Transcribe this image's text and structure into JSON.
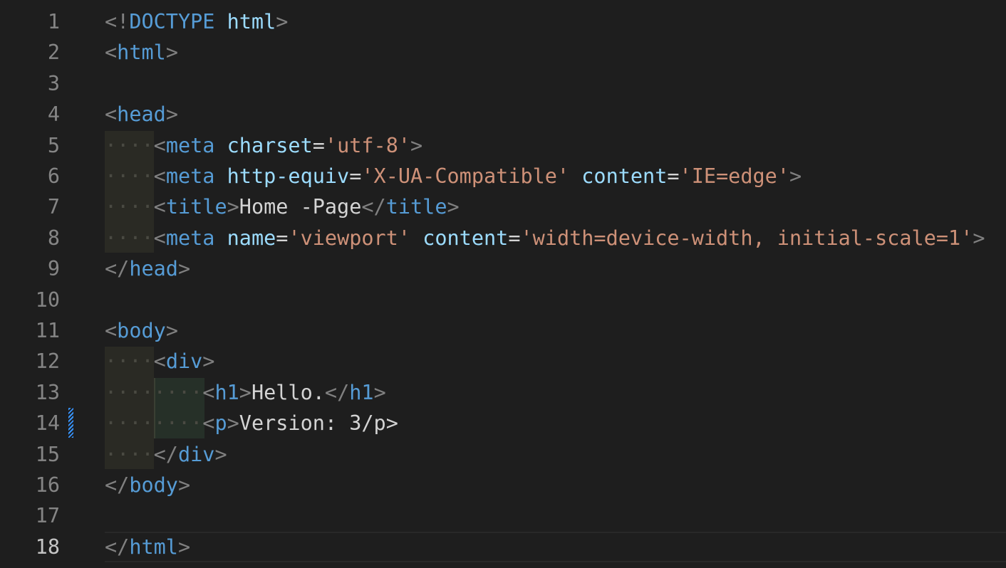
{
  "gutter": {
    "line_numbers": [
      "1",
      "2",
      "3",
      "4",
      "5",
      "6",
      "7",
      "8",
      "9",
      "10",
      "11",
      "12",
      "13",
      "14",
      "15",
      "16",
      "17",
      "18"
    ]
  },
  "code_lines": [
    {
      "tokens": [
        {
          "c": "p",
          "t": "<!"
        },
        {
          "c": "t",
          "t": "DOCTYPE"
        },
        {
          "c": "tx",
          "t": " "
        },
        {
          "c": "a",
          "t": "html"
        },
        {
          "c": "p",
          "t": ">"
        }
      ]
    },
    {
      "tokens": [
        {
          "c": "p",
          "t": "<"
        },
        {
          "c": "t",
          "t": "html"
        },
        {
          "c": "p",
          "t": ">"
        }
      ]
    },
    {
      "tokens": []
    },
    {
      "tokens": [
        {
          "c": "p",
          "t": "<"
        },
        {
          "c": "t",
          "t": "head"
        },
        {
          "c": "p",
          "t": ">"
        }
      ]
    },
    {
      "tokens": [
        {
          "c": "ws",
          "t": "····"
        },
        {
          "c": "p",
          "t": "<"
        },
        {
          "c": "t",
          "t": "meta"
        },
        {
          "c": "tx",
          "t": " "
        },
        {
          "c": "a",
          "t": "charset"
        },
        {
          "c": "tx",
          "t": "="
        },
        {
          "c": "s",
          "t": "'utf-8'"
        },
        {
          "c": "p",
          "t": ">"
        }
      ]
    },
    {
      "tokens": [
        {
          "c": "ws",
          "t": "····"
        },
        {
          "c": "p",
          "t": "<"
        },
        {
          "c": "t",
          "t": "meta"
        },
        {
          "c": "tx",
          "t": " "
        },
        {
          "c": "a",
          "t": "http-equiv"
        },
        {
          "c": "tx",
          "t": "="
        },
        {
          "c": "s",
          "t": "'X-UA-Compatible'"
        },
        {
          "c": "tx",
          "t": " "
        },
        {
          "c": "a",
          "t": "content"
        },
        {
          "c": "tx",
          "t": "="
        },
        {
          "c": "s",
          "t": "'IE=edge'"
        },
        {
          "c": "p",
          "t": ">"
        }
      ]
    },
    {
      "tokens": [
        {
          "c": "ws",
          "t": "····"
        },
        {
          "c": "p",
          "t": "<"
        },
        {
          "c": "t",
          "t": "title"
        },
        {
          "c": "p",
          "t": ">"
        },
        {
          "c": "tx",
          "t": "Home -Page"
        },
        {
          "c": "p",
          "t": "</"
        },
        {
          "c": "t",
          "t": "title"
        },
        {
          "c": "p",
          "t": ">"
        }
      ]
    },
    {
      "tokens": [
        {
          "c": "ws",
          "t": "····"
        },
        {
          "c": "p",
          "t": "<"
        },
        {
          "c": "t",
          "t": "meta"
        },
        {
          "c": "tx",
          "t": " "
        },
        {
          "c": "a",
          "t": "name"
        },
        {
          "c": "tx",
          "t": "="
        },
        {
          "c": "s",
          "t": "'viewport'"
        },
        {
          "c": "tx",
          "t": " "
        },
        {
          "c": "a",
          "t": "content"
        },
        {
          "c": "tx",
          "t": "="
        },
        {
          "c": "s",
          "t": "'width=device-width, initial-scale=1'"
        },
        {
          "c": "p",
          "t": ">"
        }
      ]
    },
    {
      "tokens": [
        {
          "c": "p",
          "t": "</"
        },
        {
          "c": "t",
          "t": "head"
        },
        {
          "c": "p",
          "t": ">"
        }
      ]
    },
    {
      "tokens": []
    },
    {
      "tokens": [
        {
          "c": "p",
          "t": "<"
        },
        {
          "c": "t",
          "t": "body"
        },
        {
          "c": "p",
          "t": ">"
        }
      ]
    },
    {
      "tokens": [
        {
          "c": "ws",
          "t": "····"
        },
        {
          "c": "p",
          "t": "<"
        },
        {
          "c": "t",
          "t": "div"
        },
        {
          "c": "p",
          "t": ">"
        }
      ]
    },
    {
      "tokens": [
        {
          "c": "ws",
          "t": "········"
        },
        {
          "c": "p",
          "t": "<"
        },
        {
          "c": "t",
          "t": "h1"
        },
        {
          "c": "p",
          "t": ">"
        },
        {
          "c": "tx",
          "t": "Hello."
        },
        {
          "c": "p",
          "t": "</"
        },
        {
          "c": "t",
          "t": "h1"
        },
        {
          "c": "p",
          "t": ">"
        }
      ]
    },
    {
      "tokens": [
        {
          "c": "ws",
          "t": "········"
        },
        {
          "c": "p",
          "t": "<"
        },
        {
          "c": "t",
          "t": "p"
        },
        {
          "c": "p",
          "t": ">"
        },
        {
          "c": "tx",
          "t": "Version: 3/p>"
        }
      ]
    },
    {
      "tokens": [
        {
          "c": "ws",
          "t": "····"
        },
        {
          "c": "p",
          "t": "</"
        },
        {
          "c": "t",
          "t": "div"
        },
        {
          "c": "p",
          "t": ">"
        }
      ]
    },
    {
      "tokens": [
        {
          "c": "p",
          "t": "</"
        },
        {
          "c": "t",
          "t": "body"
        },
        {
          "c": "p",
          "t": ">"
        }
      ]
    },
    {
      "tokens": []
    },
    {
      "tokens": [
        {
          "c": "p",
          "t": "</"
        },
        {
          "c": "t",
          "t": "html"
        },
        {
          "c": "p",
          "t": ">"
        }
      ]
    }
  ],
  "editor_state": {
    "active_line": "18",
    "modified_line": "14"
  },
  "colors": {
    "background": "#1e1e1e",
    "punctuation": "#808080",
    "tag": "#569cd6",
    "attribute": "#9cdcfe",
    "string": "#ce9178",
    "text": "#d4d4d4",
    "line_number": "#858585",
    "modified_marker": "#3794ff"
  }
}
